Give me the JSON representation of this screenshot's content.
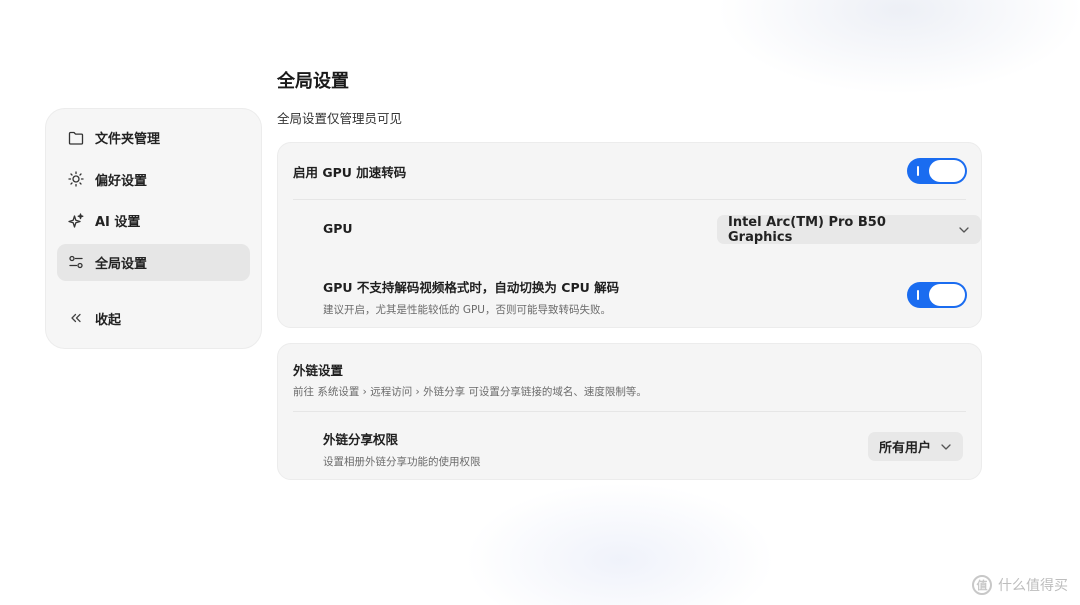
{
  "sidebar": {
    "items": [
      {
        "label": "文件夹管理",
        "icon": "folder-icon"
      },
      {
        "label": "偏好设置",
        "icon": "sun-icon"
      },
      {
        "label": "AI 设置",
        "icon": "sparkle-icon"
      },
      {
        "label": "全局设置",
        "icon": "sliders-icon",
        "active": true
      }
    ],
    "collapse_label": "收起",
    "collapse_icon": "double-chevron-left-icon"
  },
  "main": {
    "title": "全局设置",
    "subtitle": "全局设置仅管理员可见",
    "gpu_card": {
      "enable_label": "启用 GPU 加速转码",
      "enable_on": true,
      "gpu_label": "GPU",
      "gpu_selected": "Intel Arc(TM) Pro B50 Graphics",
      "fallback_label": "GPU 不支持解码视频格式时，自动切换为 CPU 解码",
      "fallback_desc": "建议开启，尤其是性能较低的 GPU，否则可能导致转码失败。",
      "fallback_on": true
    },
    "share_card": {
      "title": "外链设置",
      "desc": "前往 系统设置 › 远程访问 › 外链分享 可设置分享链接的域名、速度限制等。",
      "permission_label": "外链分享权限",
      "permission_desc": "设置相册外链分享功能的使用权限",
      "permission_selected": "所有用户"
    }
  },
  "colors": {
    "accent": "#1a6cf0",
    "card_bg": "#f5f5f5",
    "sidebar_active_bg": "#e6e6e6"
  },
  "watermark": {
    "text": "什么值得买",
    "logo_text": "值"
  }
}
